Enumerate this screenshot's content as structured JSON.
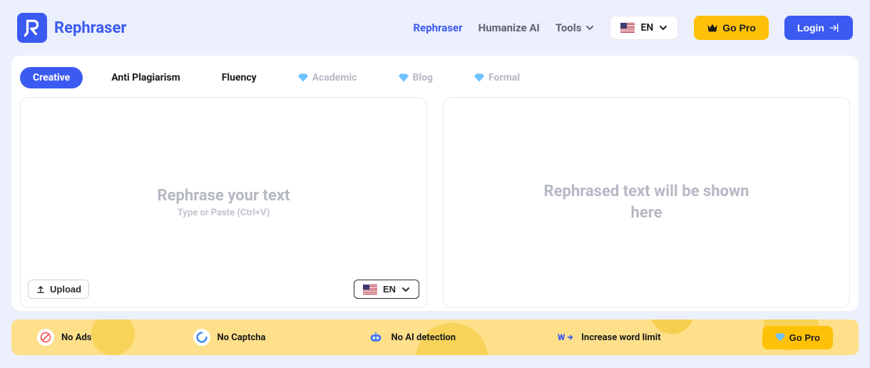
{
  "header": {
    "brand": "Rephraser",
    "nav": {
      "rephraser": "Rephraser",
      "humanize": "Humanize AI",
      "tools": "Tools"
    },
    "lang": "EN",
    "gopro": "Go Pro",
    "login": "Login"
  },
  "tabs": {
    "creative": "Creative",
    "anti_plagiarism": "Anti Plagiarism",
    "fluency": "Fluency",
    "academic": "Academic",
    "blog": "Blog",
    "formal": "Formal"
  },
  "input_panel": {
    "title": "Rephrase your text",
    "hint": "Type or Paste (Ctrl+V)",
    "upload": "Upload",
    "lang": "EN"
  },
  "output_panel": {
    "placeholder": "Rephrased text will be shown here"
  },
  "promo": {
    "no_ads": "No Ads",
    "no_captcha": "No Captcha",
    "no_ai_detection": "No AI detection",
    "word_limit": "Increase word limit",
    "gopro": "Go Pro"
  }
}
